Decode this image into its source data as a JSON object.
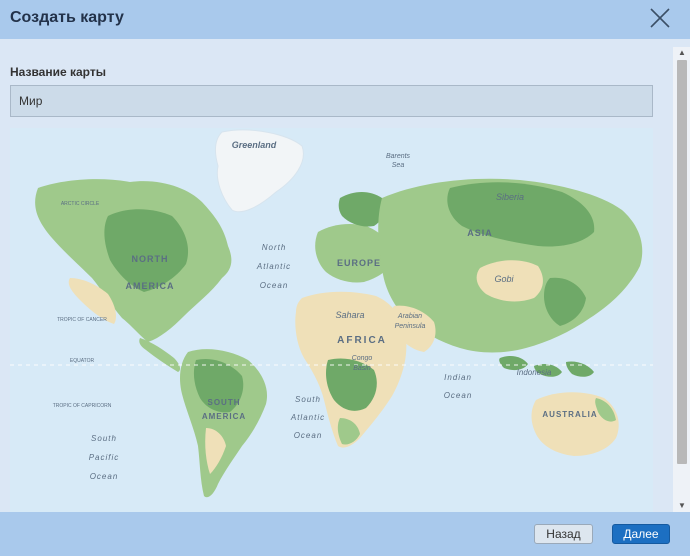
{
  "dialog": {
    "title": "Создать карту",
    "close_icon": "close-icon"
  },
  "form": {
    "name_label": "Название карты",
    "name_value": "Мир"
  },
  "map": {
    "labels": {
      "greenland": "Greenland",
      "barents_sea": "Barents\nSea",
      "siberia": "Siberia",
      "arctic_circle": "ARCTIC CIRCLE",
      "asia": "ASIA",
      "north_america": "NORTH\nAMERICA",
      "europe": "EUROPE",
      "north_atlantic": "North\nAtlantic\nOcean",
      "gobi": "Gobi",
      "sahara": "Sahara",
      "arabian_peninsula": "Arabian\nPeninsula",
      "tropic_cancer": "TROPIC OF CANCER",
      "africa": "AFRICA",
      "equator": "EQUATOR",
      "congo_basin": "Congo\nBasin",
      "indonesia": "Indonesia",
      "indian_ocean": "Indian\nOcean",
      "tropic_capricorn": "TROPIC OF CAPRICORN",
      "south_america": "SOUTH\nAMERICA",
      "south_atlantic": "South\nAtlantic\nOcean",
      "australia": "AUSTRALIA",
      "south_pacific": "South\nPacific\nOcean"
    },
    "colors": {
      "ocean": "#d7eaf7",
      "land_green": "#9fc98b",
      "land_dark_green": "#6fa968",
      "desert": "#efe0b8",
      "ice": "#f2f5f7"
    }
  },
  "footer": {
    "back_label": "Назад",
    "next_label": "Далее"
  }
}
